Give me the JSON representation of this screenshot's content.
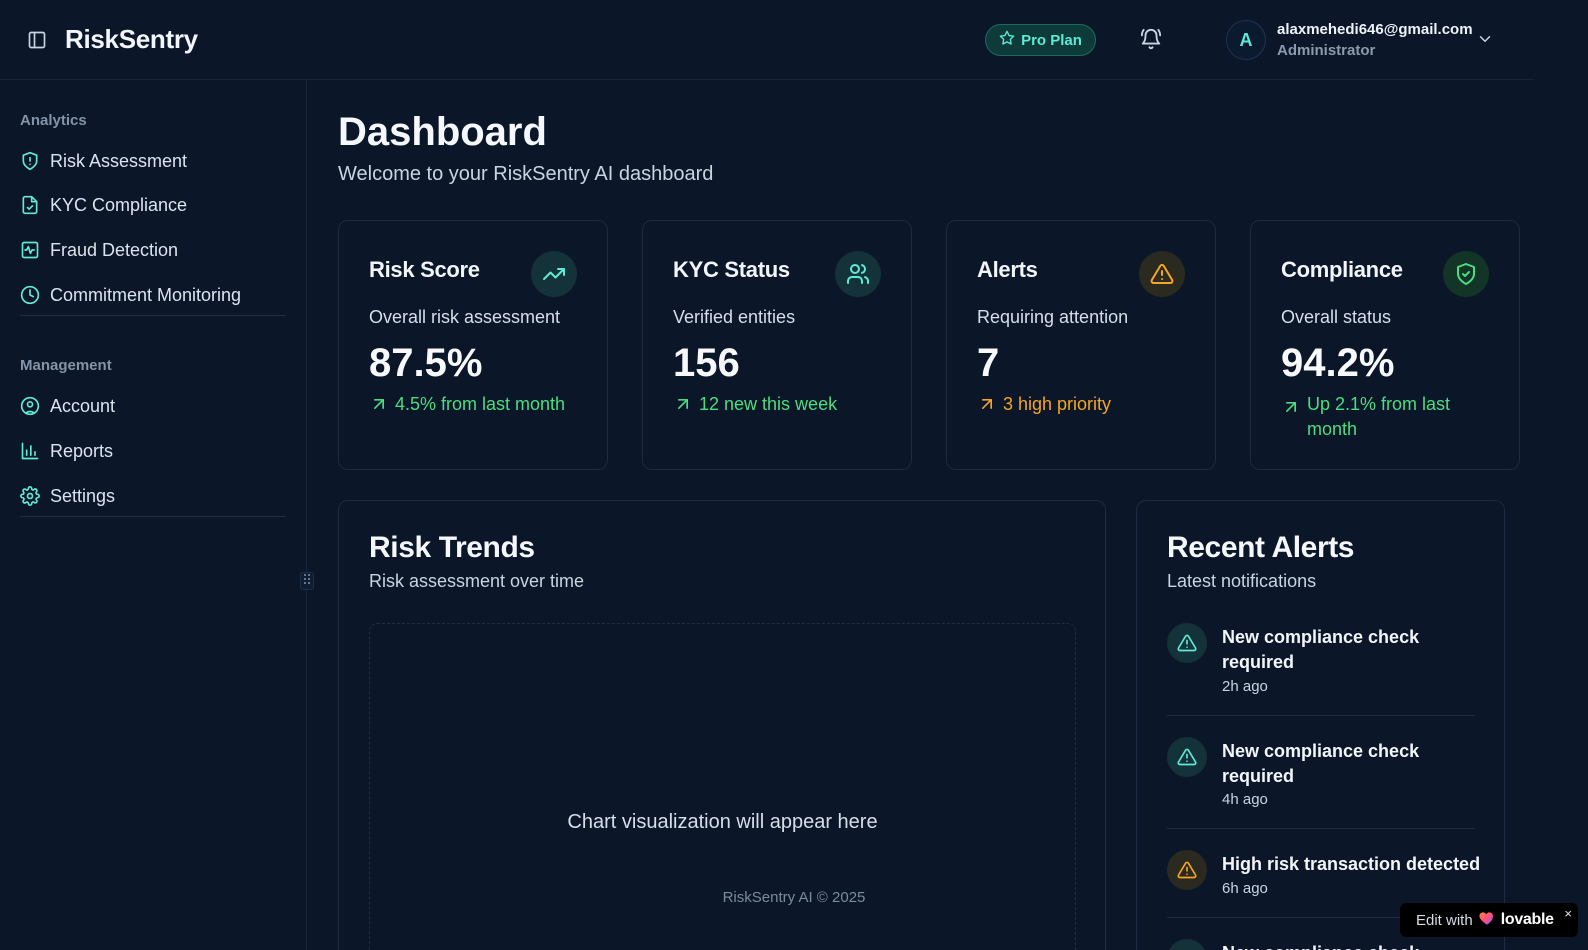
{
  "header": {
    "brand": "RiskSentry",
    "plan_label": "Pro Plan",
    "user": {
      "initial": "A",
      "email": "alaxmehedi646@gmail.com",
      "role": "Administrator"
    }
  },
  "sidebar": {
    "analytics_label": "Analytics",
    "analytics_items": [
      {
        "label": "Risk Assessment",
        "icon": "shield-alert-icon"
      },
      {
        "label": "KYC Compliance",
        "icon": "file-check-icon"
      },
      {
        "label": "Fraud Detection",
        "icon": "activity-icon"
      },
      {
        "label": "Commitment Monitoring",
        "icon": "clock-icon"
      }
    ],
    "management_label": "Management",
    "management_items": [
      {
        "label": "Account",
        "icon": "user-circle-icon"
      },
      {
        "label": "Reports",
        "icon": "bar-chart-icon"
      },
      {
        "label": "Settings",
        "icon": "gear-icon"
      }
    ]
  },
  "page": {
    "title": "Dashboard",
    "subtitle": "Welcome to your RiskSentry AI dashboard"
  },
  "stats": [
    {
      "title": "Risk Score",
      "desc": "Overall risk assessment",
      "value": "87.5%",
      "trend": "4.5% from last month",
      "trend_color": "#4ade80",
      "icon": "trending-up-icon"
    },
    {
      "title": "KYC Status",
      "desc": "Verified entities",
      "value": "156",
      "trend": "12 new this week",
      "trend_color": "#4ade80",
      "icon": "users-icon"
    },
    {
      "title": "Alerts",
      "desc": "Requiring attention",
      "value": "7",
      "trend": "3 high priority",
      "trend_color": "#f5a524",
      "icon": "warning-icon"
    },
    {
      "title": "Compliance",
      "desc": "Overall status",
      "value": "94.2%",
      "trend": "Up 2.1% from last month",
      "trend_color": "#4ade80",
      "icon": "shield-check-icon"
    }
  ],
  "trends": {
    "title": "Risk Trends",
    "subtitle": "Risk assessment over time",
    "placeholder": "Chart visualization will appear here",
    "footer": "RiskSentry AI © 2025"
  },
  "alerts": {
    "title": "Recent Alerts",
    "subtitle": "Latest notifications",
    "items": [
      {
        "title": "New compliance check required",
        "time": "2h ago",
        "severity": "info"
      },
      {
        "title": "New compliance check required",
        "time": "4h ago",
        "severity": "info"
      },
      {
        "title": "High risk transaction detected",
        "time": "6h ago",
        "severity": "high"
      },
      {
        "title": "New compliance check",
        "time": "",
        "severity": "info"
      }
    ]
  },
  "badge": {
    "edit_label": "Edit with",
    "brand": "lovable",
    "close": "×"
  },
  "colors": {
    "accent": "#5eead4",
    "background": "#0b1629",
    "success": "#4ade80",
    "warning": "#f5a524"
  }
}
